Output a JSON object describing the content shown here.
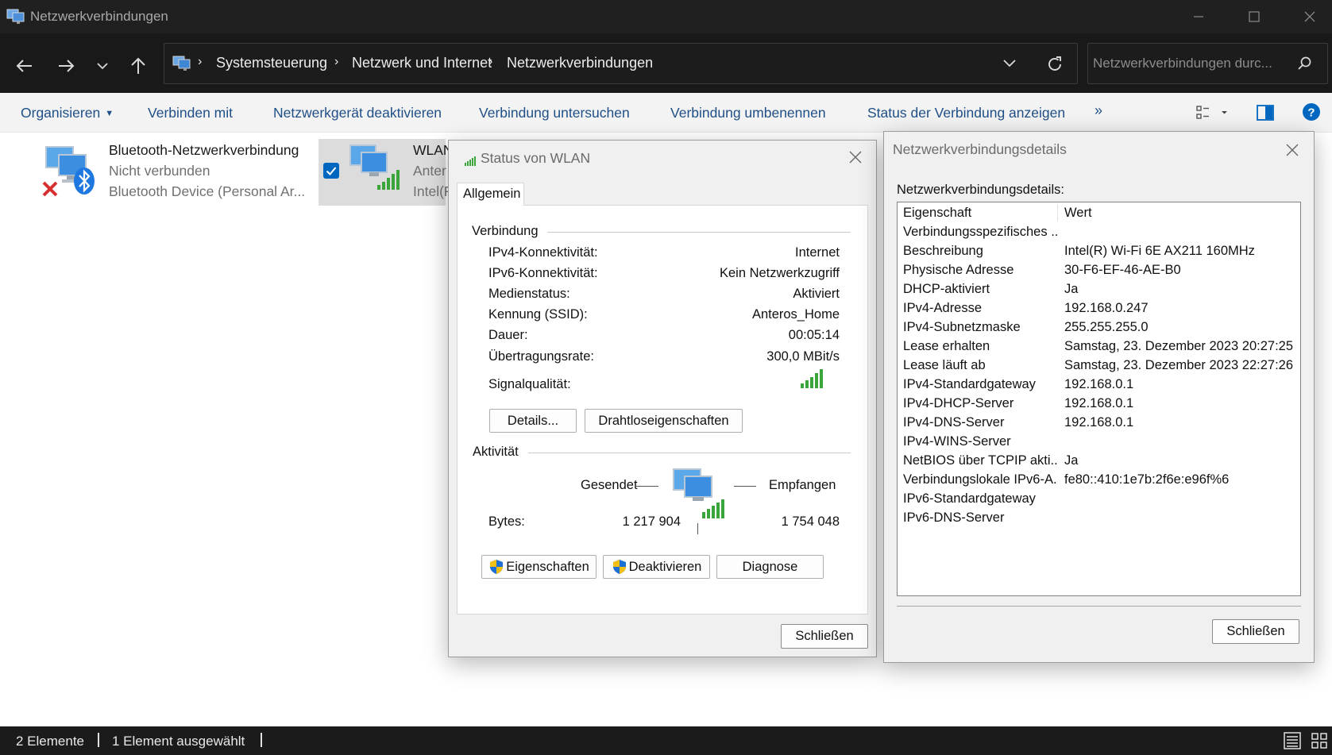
{
  "window": {
    "title": "Netzwerkverbindungen"
  },
  "address": {
    "crumbs": [
      "Systemsteuerung",
      "Netzwerk und Internet",
      "Netzwerkverbindungen"
    ],
    "search_placeholder": "Netzwerkverbindungen durc..."
  },
  "commands": {
    "organize": "Organisieren",
    "connect": "Verbinden mit",
    "disable": "Netzwerkgerät deaktivieren",
    "diagnose": "Verbindung untersuchen",
    "rename": "Verbindung umbenennen",
    "status": "Status der Verbindung anzeigen",
    "more": "»"
  },
  "items": [
    {
      "name": "Bluetooth-Netzwerkverbindung",
      "status": "Nicht verbunden",
      "device": "Bluetooth Device (Personal Ar..."
    },
    {
      "name": "WLAN",
      "status": "Anter",
      "device": "Intel(F"
    }
  ],
  "status_bar": {
    "count": "2 Elemente",
    "selected": "1 Element ausgewählt"
  },
  "wlan_dialog": {
    "title": "Status von WLAN",
    "tab": "Allgemein",
    "connection_header": "Verbindung",
    "rows": [
      {
        "label": "IPv4-Konnektivität:",
        "value": "Internet"
      },
      {
        "label": "IPv6-Konnektivität:",
        "value": "Kein Netzwerkzugriff"
      },
      {
        "label": "Medienstatus:",
        "value": "Aktiviert"
      },
      {
        "label": "Kennung (SSID):",
        "value": "Anteros_Home"
      },
      {
        "label": "Dauer:",
        "value": "00:05:14"
      },
      {
        "label": "Übertragungsrate:",
        "value": "300,0 MBit/s"
      }
    ],
    "signal_label": "Signalqualität:",
    "details_button": "Details...",
    "wireless_button": "Drahtloseigenschaften",
    "activity_header": "Aktivität",
    "sent_label": "Gesendet",
    "received_label": "Empfangen",
    "bytes_label": "Bytes:",
    "bytes_sent": "1 217 904",
    "bytes_received": "1 754 048",
    "properties_button": "Eigenschaften",
    "deactivate_button": "Deaktivieren",
    "diagnose_button": "Diagnose",
    "close_button": "Schließen"
  },
  "details_dialog": {
    "title": "Netzwerkverbindungsdetails",
    "subtitle": "Netzwerkverbindungsdetails:",
    "col_property": "Eigenschaft",
    "col_value": "Wert",
    "rows": [
      {
        "property": "Verbindungsspezifisches ...",
        "value": ""
      },
      {
        "property": "Beschreibung",
        "value": "Intel(R) Wi-Fi 6E AX211 160MHz"
      },
      {
        "property": "Physische Adresse",
        "value": "30-F6-EF-46-AE-B0"
      },
      {
        "property": "DHCP-aktiviert",
        "value": "Ja"
      },
      {
        "property": "IPv4-Adresse",
        "value": "192.168.0.247"
      },
      {
        "property": "IPv4-Subnetzmaske",
        "value": "255.255.255.0"
      },
      {
        "property": "Lease erhalten",
        "value": "Samstag, 23. Dezember 2023 20:27:25"
      },
      {
        "property": "Lease läuft ab",
        "value": "Samstag, 23. Dezember 2023 22:27:26"
      },
      {
        "property": "IPv4-Standardgateway",
        "value": "192.168.0.1"
      },
      {
        "property": "IPv4-DHCP-Server",
        "value": "192.168.0.1"
      },
      {
        "property": "IPv4-DNS-Server",
        "value": "192.168.0.1"
      },
      {
        "property": "IPv4-WINS-Server",
        "value": ""
      },
      {
        "property": "NetBIOS über TCPIP akti...",
        "value": "Ja"
      },
      {
        "property": "Verbindungslokale IPv6-A...",
        "value": "fe80::410:1e7b:2f6e:e96f%6"
      },
      {
        "property": "IPv6-Standardgateway",
        "value": ""
      },
      {
        "property": "IPv6-DNS-Server",
        "value": ""
      }
    ],
    "close_button": "Schließen"
  },
  "colors": {
    "accent": "#0067c0",
    "title_bg": "#202020",
    "cmd_text": "#1f4f86",
    "signal_green": "#3aa53a"
  }
}
